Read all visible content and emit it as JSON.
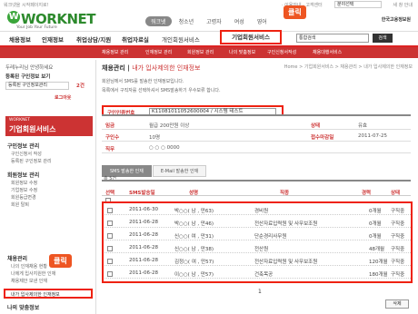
{
  "topbar": {
    "left_text": "워크넷을 시작페이지로!",
    "right_links": "· 이용안내 · 고객센터",
    "select_value": "분야선택",
    "site_label": "새 창 안내"
  },
  "header": {
    "logo_text": "WORKNET",
    "tagline": "Your Job Your Future",
    "top_tabs": [
      "워크넷",
      "청소년",
      "고령자",
      "여성",
      "영어"
    ],
    "ministry": "한국고용정보원"
  },
  "nav": {
    "items": [
      "채용정보",
      "인재정보",
      "취업상담/지원",
      "취업자료실",
      "개인회원서비스",
      "기업회원서비스"
    ],
    "search_placeholder": "통합검색",
    "search_button": "검색",
    "click_label": "클릭"
  },
  "subnav": {
    "items": [
      "채용정보 관리",
      "인재정보 관리",
      "회원정보 관리",
      "나의 맞춤정보",
      "구인신청서작성",
      "채용대행서비스"
    ]
  },
  "sidebar": {
    "login_title": "등록된 구인정보 보기",
    "login_status": "두레누리님 안녕하세요",
    "manage_label": "등록된 구인정보관리",
    "count": "2건",
    "logout": "로그아웃",
    "box_title_small": "WORKNET",
    "box_title": "기업회원서비스",
    "sections": [
      {
        "title": "구인정보 관리",
        "items": [
          "구인신청서 작성",
          "등록된 구인정보 관리"
        ]
      },
      {
        "title": "회원정보 관리",
        "items": [
          "회원정보 수정",
          "기업정보 수정",
          "회원등급변경",
          "회원 탈퇴"
        ]
      },
      {
        "title": "채용관리",
        "items": [
          "나의 인재채용 현황",
          "나에게 입사지원한 인재",
          "채용제안 보낸 인재",
          "내가 입사제의한 인재정보"
        ]
      },
      {
        "title": "나의 맞춤정보",
        "items": [
          "맞춤정보 설정",
          "맞춤정보 보기"
        ]
      }
    ],
    "click_label": "클릭"
  },
  "main": {
    "breadcrumb": "Home > 기업회원서비스 > 채용관리 > 내가 입사제의한 인재정보",
    "title": "채용관리",
    "title_sub": "내가 입사제의한 인재정보",
    "notes": [
      "회원님께서 SMS를 발송한 인재정보입니다.",
      "목록에서 구직자를 선택하셔서 SMS발송하기 우수보류 합니다."
    ],
    "select_label": "구인인증번호",
    "select_value": "K11081011052600004 / 시스템 테스트",
    "info": [
      {
        "label": "임금",
        "value": "월급 200만원 이상",
        "label2": "상태",
        "value2": "유효"
      },
      {
        "label": "구인수",
        "value": "10명",
        "label2": "접수마감일",
        "value2": "2011-07-25"
      },
      {
        "label": "직무",
        "value": "○ ○ ○ 0000",
        "label2": "",
        "value2": ""
      }
    ],
    "tabs": [
      "SMS 발송한 인재",
      "E-Mail 발송한 인재"
    ],
    "total": "총 5건",
    "columns": [
      "선택",
      "SMS발송일",
      "성명",
      "직종",
      "경력",
      "상태"
    ],
    "rows": [
      {
        "date": "2011-06-30",
        "name": "박○○( 남 , 만63)",
        "job": "경비원",
        "career": "0개월",
        "status": "구직중"
      },
      {
        "date": "2011-06-28",
        "name": "박○○( 남 , 만46)",
        "job": "전산자료입력원 및 사무보조원",
        "career": "0개월",
        "status": "구직중"
      },
      {
        "date": "2011-06-28",
        "name": "신○○( 여 , 만31)",
        "job": "단순경리사무원",
        "career": "0개월",
        "status": "구직중"
      },
      {
        "date": "2011-06-28",
        "name": "신○○( 남 , 만38)",
        "job": "전산원",
        "career": "48개월",
        "status": "구직중"
      },
      {
        "date": "2011-06-28",
        "name": "김정○( 여 , 만57)",
        "job": "전산자료입력원 및 사무보조원",
        "career": "120개월",
        "status": "구직중"
      },
      {
        "date": "2011-06-28",
        "name": "이○○( 남 , 만57)",
        "job": "건축목공",
        "career": "180개월",
        "status": "구직중"
      }
    ],
    "page": "1",
    "delete_button": "삭제"
  },
  "colors": {
    "accent": "#cc3333",
    "highlight": "#ee2211",
    "logo": "#2d8a2d"
  }
}
